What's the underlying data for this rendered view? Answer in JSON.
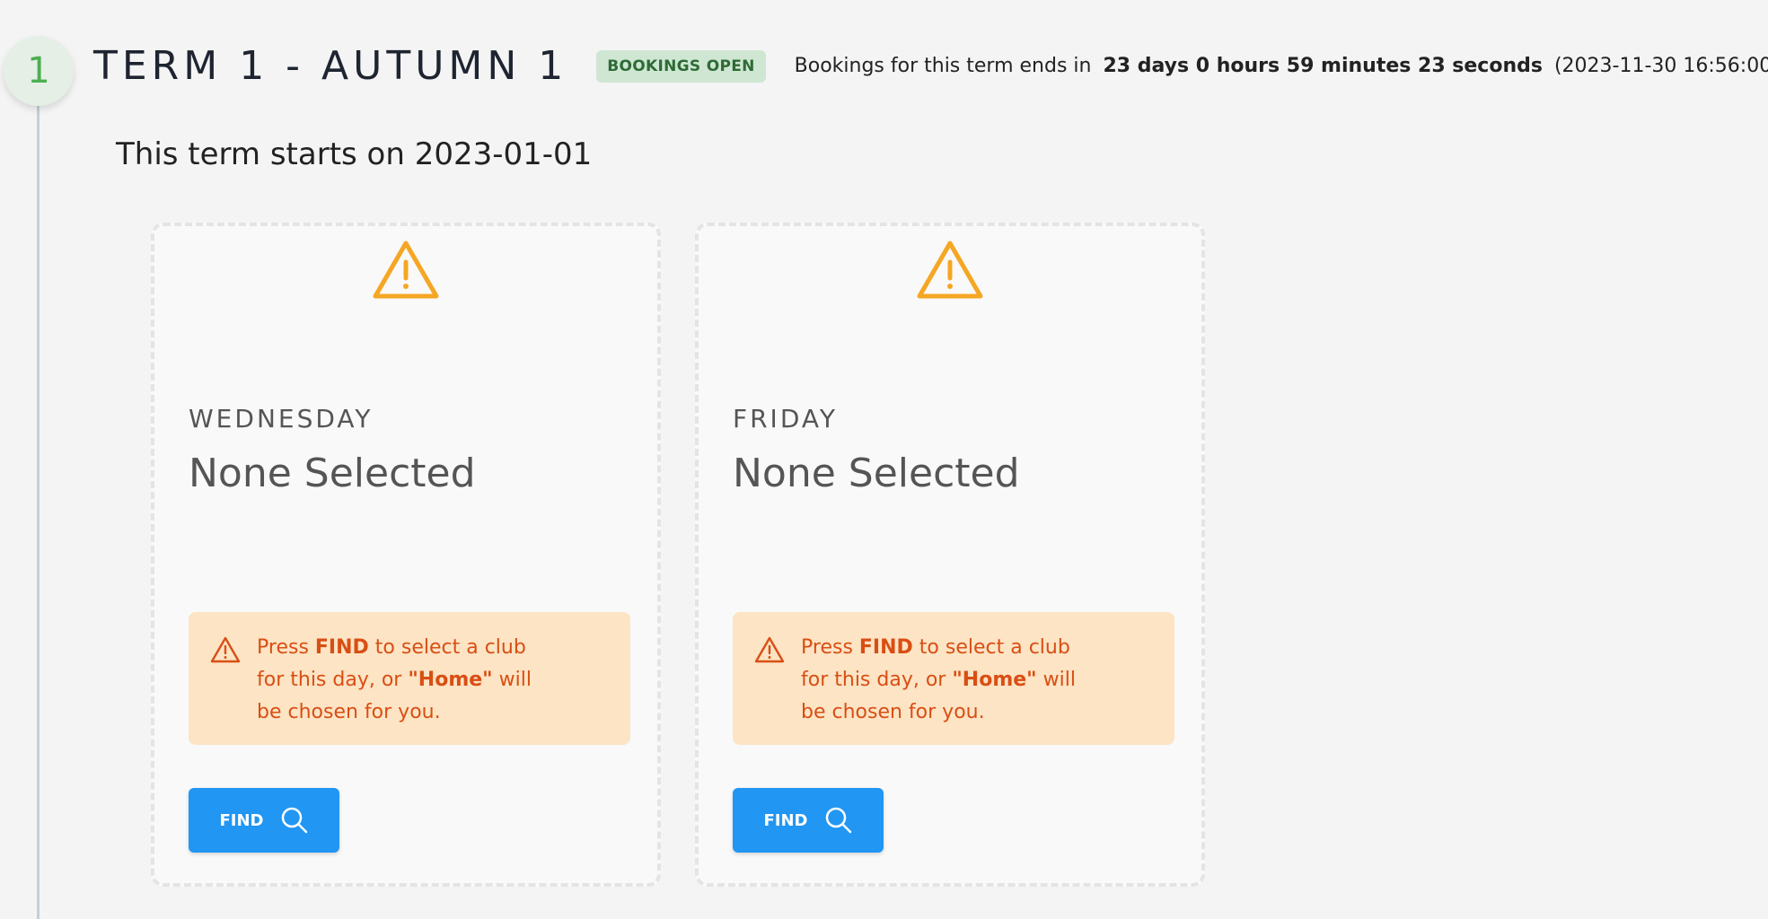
{
  "term": {
    "step_number": "1",
    "title": "TERM 1 - AUTUMN 1",
    "status_badge": "BOOKINGS OPEN",
    "countdown_prefix": "Bookings for this term ends in",
    "countdown_value": "23 days 0 hours 59 minutes 23 seconds",
    "deadline": "(2023-11-30 16:56:00)",
    "start_text": "This term starts on 2023-01-01"
  },
  "cards": [
    {
      "day": "WEDNESDAY",
      "selection": "None Selected",
      "alert": {
        "text_1": "Press ",
        "bold_1": "FIND",
        "text_2": " to select a club",
        "text_3": "for this day, or ",
        "bold_2": "\"Home\"",
        "text_4": " will",
        "text_5": "be chosen for you."
      },
      "button_label": "FIND"
    },
    {
      "day": "FRIDAY",
      "selection": "None Selected",
      "alert": {
        "text_1": "Press ",
        "bold_1": "FIND",
        "text_2": " to select a club",
        "text_3": "for this day, or ",
        "bold_2": "\"Home\"",
        "text_4": " will",
        "text_5": "be chosen for you."
      },
      "button_label": "FIND"
    }
  ],
  "colors": {
    "accent": "#2196f3",
    "warning": "#f5a623",
    "alert_text": "#d94e14",
    "alert_bg": "#fce4c4",
    "badge_bg": "#cfe6d3",
    "step_green": "#4caf50"
  },
  "icons": {
    "card_warning": "warning-triangle-icon",
    "alert_warning": "alert-triangle-icon",
    "search": "search-icon"
  }
}
